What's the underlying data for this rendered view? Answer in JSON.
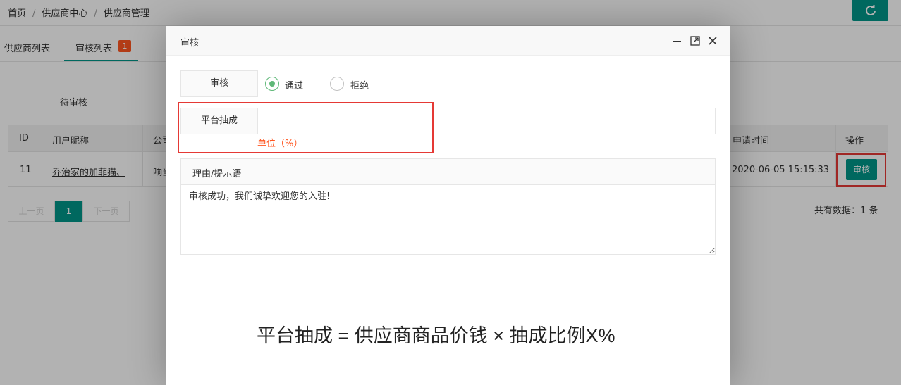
{
  "breadcrumb": [
    "首页",
    "供应商中心",
    "供应商管理"
  ],
  "tabs": [
    {
      "label": "供应商列表"
    },
    {
      "label": "审核列表",
      "badge": "1"
    }
  ],
  "filter": {
    "status_value": "待审核"
  },
  "table": {
    "columns": [
      "ID",
      "用户昵称",
      "公司",
      "申请时间",
      "操作"
    ],
    "rows": [
      {
        "id": "11",
        "nickname": "乔治家的加菲猫、",
        "company": "响当",
        "apply_time": "2020-06-05 15:15:33",
        "action": "审核"
      }
    ]
  },
  "pagination": {
    "prev": "上一页",
    "current": "1",
    "next": "下一页"
  },
  "total_text": "共有数据：1 条",
  "modal": {
    "title": "审核",
    "audit_label": "审核",
    "options": [
      "通过",
      "拒绝"
    ],
    "selected_option": "通过",
    "commission_label": "平台抽成",
    "commission_value": "",
    "commission_hint": "单位（%）",
    "reason_label": "理由/提示语",
    "reason_text": "审核成功，我们诚挚欢迎您的入驻!"
  },
  "annotation": "平台抽成 = 供应商商品价钱 × 抽成比例X%",
  "colors": {
    "accent": "#009688",
    "badge": "#ff5722",
    "highlight": "#e53935",
    "radio_on": "#5fb878"
  }
}
